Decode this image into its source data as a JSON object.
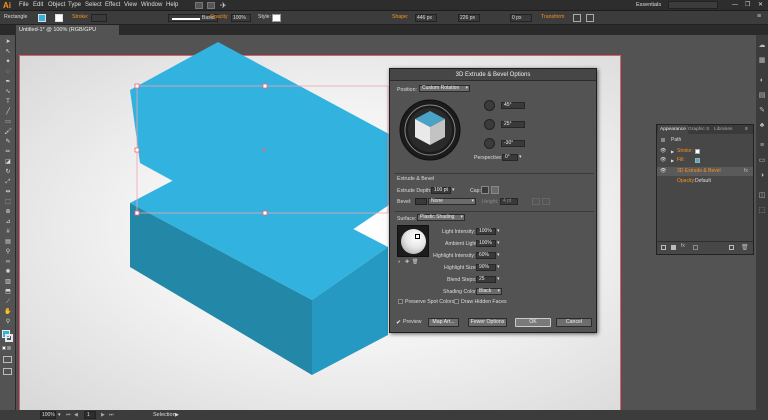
{
  "app": {
    "logo": "Ai",
    "workspace": "Essentials"
  },
  "menu": [
    "File",
    "Edit",
    "Object",
    "Type",
    "Select",
    "Effect",
    "View",
    "Window",
    "Help"
  ],
  "control": {
    "selection_label": "Rectangle",
    "stroke_label": "Stroke:",
    "brush_label": "Basic",
    "opacity_label": "Opacity",
    "opacity_value": "100%",
    "style_label": "Style:",
    "shape_label": "Shape:",
    "width_value": "446 px",
    "height_value": "226 px",
    "corner_value": "0 px",
    "transform_label": "Transform"
  },
  "doc_tab": {
    "title": "Untitled-1* @ 100% (RGB/GPU Preview)",
    "close": "×"
  },
  "colors": {
    "shape_top": "#32b2df",
    "shape_side": "#2388a8",
    "shape_front": "#2599c1",
    "ui_bg": "#535353",
    "accent_orange": "#f7931e"
  },
  "dialog": {
    "title": "3D Extrude & Bevel Options",
    "position_label": "Position:",
    "position_value": "Custom Rotation",
    "rot_x": "45°",
    "rot_y": "25°",
    "rot_z": "-30°",
    "perspective_label": "Perspective:",
    "perspective_value": "0°",
    "extrude_section": "Extrude & Bevel",
    "extrude_depth_label": "Extrude Depth:",
    "extrude_depth_value": "100 pt",
    "cap_label": "Cap:",
    "bevel_label": "Bevel:",
    "bevel_value": "None",
    "height_label": "Height:",
    "height_value": "4 pt",
    "surface_label": "Surface:",
    "surface_value": "Plastic Shading",
    "light_intensity_label": "Light Intensity:",
    "light_intensity_value": "100%",
    "ambient_light_label": "Ambient Light:",
    "ambient_light_value": "100%",
    "highlight_intensity_label": "Highlight Intensity:",
    "highlight_intensity_value": "60%",
    "highlight_size_label": "Highlight Size:",
    "highlight_size_value": "90%",
    "blend_steps_label": "Blend Steps:",
    "blend_steps_value": "25",
    "shading_color_label": "Shading Color:",
    "shading_color_value": "Black",
    "preserve_spot": "Preserve Spot Colors",
    "draw_hidden": "Draw Hidden Faces",
    "preview_label": "Preview",
    "map_art": "Map Art...",
    "fewer_options": "Fewer Options",
    "ok": "OK",
    "cancel": "Cancel"
  },
  "appearance": {
    "tabs": [
      "Appearance",
      "Graphic S",
      "Libraries"
    ],
    "object": "Path",
    "rows": [
      {
        "label": "Stroke:",
        "swatch": "none"
      },
      {
        "label": "Fill:",
        "swatch": "#32b2df"
      },
      {
        "label": "3D Extrude & Bevel",
        "swatch": "fx"
      },
      {
        "label": "Opacity:",
        "value": "Default"
      }
    ]
  },
  "status": {
    "zoom": "100%",
    "page": "1",
    "mode": "Selection"
  }
}
